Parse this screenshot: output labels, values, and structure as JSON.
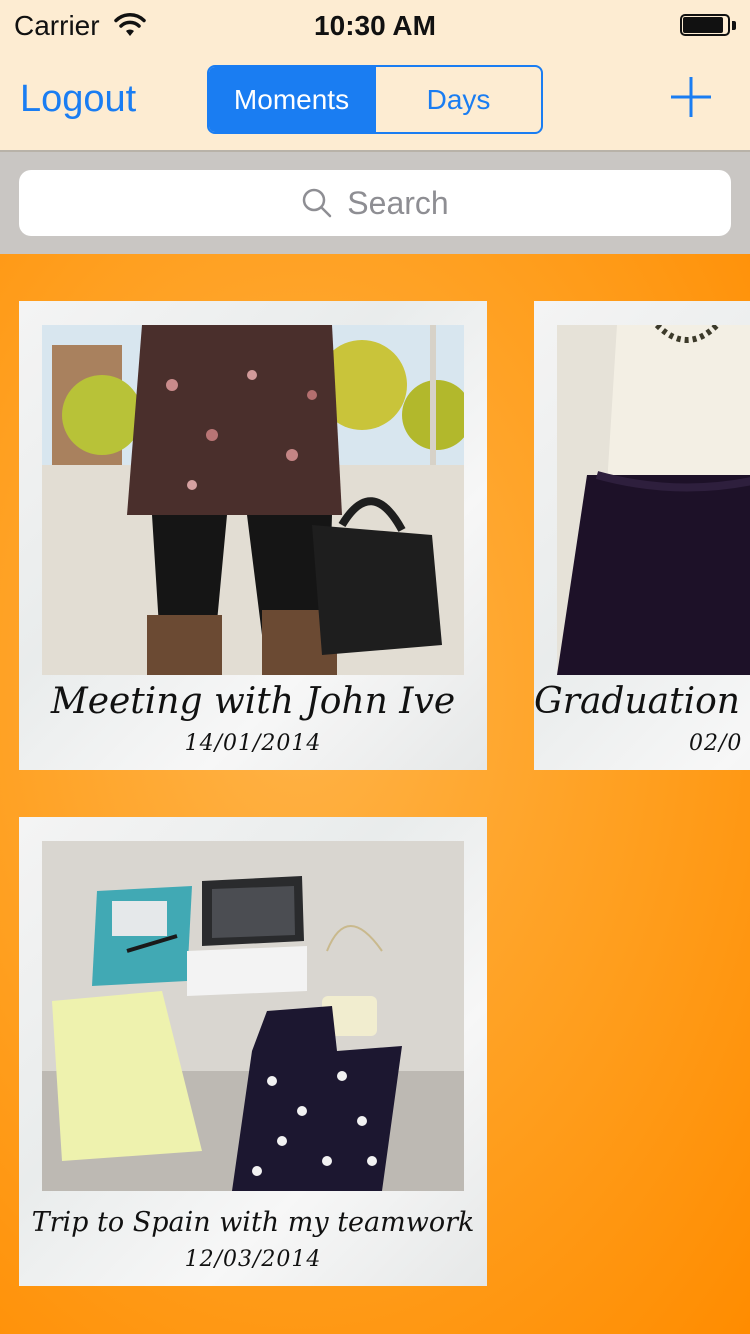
{
  "status": {
    "carrier": "Carrier",
    "time": "10:30 AM"
  },
  "nav": {
    "logout_label": "Logout",
    "segments": [
      "Moments",
      "Days"
    ],
    "selected_segment": "Moments",
    "add_icon": "plus-icon"
  },
  "search": {
    "placeholder": "Search",
    "icon": "search-icon"
  },
  "moments": [
    {
      "title": "Meeting with John Ive",
      "date": "14/01/2014"
    },
    {
      "title": "Graduation",
      "date": "02/0"
    },
    {
      "title": "Trip to Spain with my teamwork",
      "date": "12/03/2014"
    }
  ],
  "colors": {
    "accent": "#1a7df2",
    "nav_background": "#fdecd2",
    "content_background": "#ff9a1a"
  }
}
